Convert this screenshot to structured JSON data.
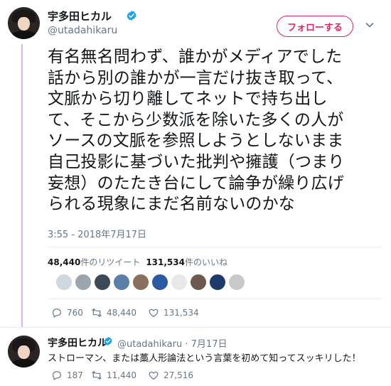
{
  "tweet": {
    "author": {
      "display_name": "宇多田ヒカル",
      "handle": "@utadahikaru",
      "verified": true
    },
    "follow_label": "フォローする",
    "text_lines": [
      "有名無名問わず、誰かがメディアでした",
      "話から別の誰かが一言だけ抜き取って、",
      "文脈から切り離してネットで持ち出し",
      "て、そこから少数派を除いた多くの人が",
      "ソースの文脈を参照しようとしないまま",
      "自己投影に基づいた批判や擁護（つまり",
      "妄想）のたたき台にして論争が繰り広げ",
      "られる現象にまだ名前ないのかな"
    ],
    "timestamp": "3:55 - 2018年7月17日",
    "stats": {
      "retweets_count": "48,440",
      "retweets_label": "件のリツイート",
      "likes_count": "131,534",
      "likes_label": "件のいいね"
    },
    "liker_colors": [
      "#cfd8dc",
      "#9aa5ad",
      "#3b4a57",
      "#5b7fa6",
      "#8a6f5c",
      "#2c5aa0",
      "#e8e8e8",
      "#6d5a4e",
      "#1f3b6b",
      "#c9c9c9"
    ],
    "actions": {
      "replies": "760",
      "retweets": "48,440",
      "likes": "131,534"
    }
  },
  "reply": {
    "display_name": "宇多田ヒカル",
    "handle": "@utadahikaru",
    "date": "7月17日",
    "separator": "·",
    "text": "ストローマン、または藁人形論法という言葉を初めて知ってスッキリした！",
    "actions": {
      "replies": "187",
      "retweets": "11,440",
      "likes": "27,516"
    }
  },
  "colors": {
    "accent": "#e0245e",
    "verified": "#1da1f2",
    "muted": "#657786",
    "thread_line": "#ddb6f0"
  },
  "icons": [
    "verified-badge-icon",
    "caret-down-icon",
    "reply-icon",
    "retweet-icon",
    "like-icon"
  ]
}
